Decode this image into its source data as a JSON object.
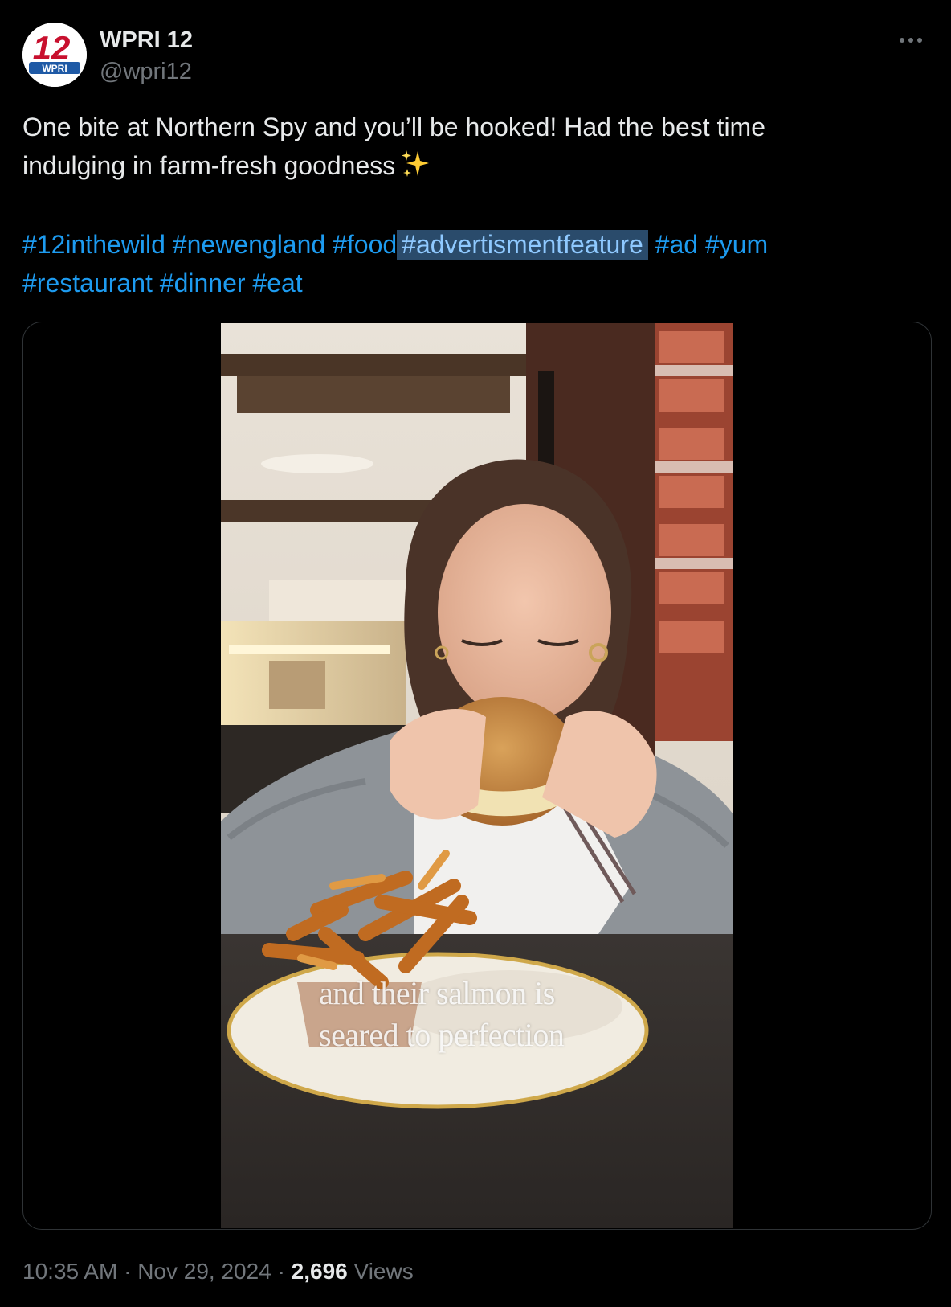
{
  "author": {
    "display_name": "WPRI 12",
    "handle": "@wpri12",
    "avatar_text": "12",
    "avatar_label": "WPRI"
  },
  "tweet": {
    "text_line1": "One bite at Northern Spy and you’ll be hooked! Had the best time",
    "text_line2": "indulging in farm-fresh goodness",
    "emoji_icon": "sparkles-icon",
    "hashtags": [
      "#12inthewild",
      "#newengland",
      "#food",
      "#advertismentfeature",
      "#ad",
      "#yum",
      "#restaurant",
      "#dinner",
      "#eat"
    ],
    "selected_hashtag_index": 3
  },
  "media": {
    "type": "video",
    "caption_line1": "and their salmon is",
    "caption_line2": "seared to perfection"
  },
  "meta": {
    "time": "10:35 AM",
    "separator": "·",
    "date": "Nov 29, 2024",
    "views_count": "2,696",
    "views_label": "Views"
  },
  "colors": {
    "background": "#000000",
    "text": "#e7e9ea",
    "secondary": "#71767b",
    "link": "#1d9bf0",
    "selection": "#2a4b6b",
    "brand_red": "#c8102e",
    "brand_blue": "#1f5aa6"
  }
}
